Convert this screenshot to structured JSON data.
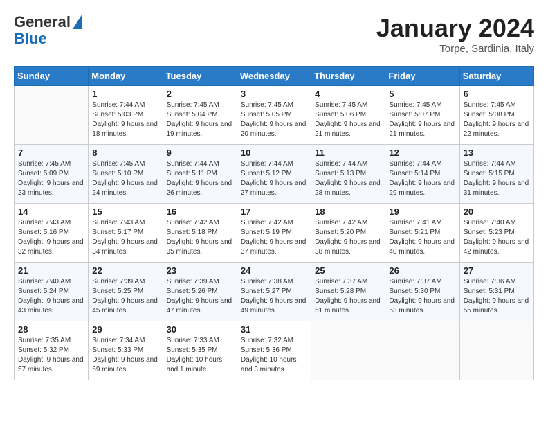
{
  "header": {
    "logo_general": "General",
    "logo_blue": "Blue",
    "month": "January 2024",
    "location": "Torpe, Sardinia, Italy"
  },
  "weekdays": [
    "Sunday",
    "Monday",
    "Tuesday",
    "Wednesday",
    "Thursday",
    "Friday",
    "Saturday"
  ],
  "weeks": [
    [
      {
        "day": "",
        "sunrise": "",
        "sunset": "",
        "daylight": ""
      },
      {
        "day": "1",
        "sunrise": "Sunrise: 7:44 AM",
        "sunset": "Sunset: 5:03 PM",
        "daylight": "Daylight: 9 hours and 18 minutes."
      },
      {
        "day": "2",
        "sunrise": "Sunrise: 7:45 AM",
        "sunset": "Sunset: 5:04 PM",
        "daylight": "Daylight: 9 hours and 19 minutes."
      },
      {
        "day": "3",
        "sunrise": "Sunrise: 7:45 AM",
        "sunset": "Sunset: 5:05 PM",
        "daylight": "Daylight: 9 hours and 20 minutes."
      },
      {
        "day": "4",
        "sunrise": "Sunrise: 7:45 AM",
        "sunset": "Sunset: 5:06 PM",
        "daylight": "Daylight: 9 hours and 21 minutes."
      },
      {
        "day": "5",
        "sunrise": "Sunrise: 7:45 AM",
        "sunset": "Sunset: 5:07 PM",
        "daylight": "Daylight: 9 hours and 21 minutes."
      },
      {
        "day": "6",
        "sunrise": "Sunrise: 7:45 AM",
        "sunset": "Sunset: 5:08 PM",
        "daylight": "Daylight: 9 hours and 22 minutes."
      }
    ],
    [
      {
        "day": "7",
        "sunrise": "Sunrise: 7:45 AM",
        "sunset": "Sunset: 5:09 PM",
        "daylight": "Daylight: 9 hours and 23 minutes."
      },
      {
        "day": "8",
        "sunrise": "Sunrise: 7:45 AM",
        "sunset": "Sunset: 5:10 PM",
        "daylight": "Daylight: 9 hours and 24 minutes."
      },
      {
        "day": "9",
        "sunrise": "Sunrise: 7:44 AM",
        "sunset": "Sunset: 5:11 PM",
        "daylight": "Daylight: 9 hours and 26 minutes."
      },
      {
        "day": "10",
        "sunrise": "Sunrise: 7:44 AM",
        "sunset": "Sunset: 5:12 PM",
        "daylight": "Daylight: 9 hours and 27 minutes."
      },
      {
        "day": "11",
        "sunrise": "Sunrise: 7:44 AM",
        "sunset": "Sunset: 5:13 PM",
        "daylight": "Daylight: 9 hours and 28 minutes."
      },
      {
        "day": "12",
        "sunrise": "Sunrise: 7:44 AM",
        "sunset": "Sunset: 5:14 PM",
        "daylight": "Daylight: 9 hours and 29 minutes."
      },
      {
        "day": "13",
        "sunrise": "Sunrise: 7:44 AM",
        "sunset": "Sunset: 5:15 PM",
        "daylight": "Daylight: 9 hours and 31 minutes."
      }
    ],
    [
      {
        "day": "14",
        "sunrise": "Sunrise: 7:43 AM",
        "sunset": "Sunset: 5:16 PM",
        "daylight": "Daylight: 9 hours and 32 minutes."
      },
      {
        "day": "15",
        "sunrise": "Sunrise: 7:43 AM",
        "sunset": "Sunset: 5:17 PM",
        "daylight": "Daylight: 9 hours and 34 minutes."
      },
      {
        "day": "16",
        "sunrise": "Sunrise: 7:42 AM",
        "sunset": "Sunset: 5:18 PM",
        "daylight": "Daylight: 9 hours and 35 minutes."
      },
      {
        "day": "17",
        "sunrise": "Sunrise: 7:42 AM",
        "sunset": "Sunset: 5:19 PM",
        "daylight": "Daylight: 9 hours and 37 minutes."
      },
      {
        "day": "18",
        "sunrise": "Sunrise: 7:42 AM",
        "sunset": "Sunset: 5:20 PM",
        "daylight": "Daylight: 9 hours and 38 minutes."
      },
      {
        "day": "19",
        "sunrise": "Sunrise: 7:41 AM",
        "sunset": "Sunset: 5:21 PM",
        "daylight": "Daylight: 9 hours and 40 minutes."
      },
      {
        "day": "20",
        "sunrise": "Sunrise: 7:40 AM",
        "sunset": "Sunset: 5:23 PM",
        "daylight": "Daylight: 9 hours and 42 minutes."
      }
    ],
    [
      {
        "day": "21",
        "sunrise": "Sunrise: 7:40 AM",
        "sunset": "Sunset: 5:24 PM",
        "daylight": "Daylight: 9 hours and 43 minutes."
      },
      {
        "day": "22",
        "sunrise": "Sunrise: 7:39 AM",
        "sunset": "Sunset: 5:25 PM",
        "daylight": "Daylight: 9 hours and 45 minutes."
      },
      {
        "day": "23",
        "sunrise": "Sunrise: 7:39 AM",
        "sunset": "Sunset: 5:26 PM",
        "daylight": "Daylight: 9 hours and 47 minutes."
      },
      {
        "day": "24",
        "sunrise": "Sunrise: 7:38 AM",
        "sunset": "Sunset: 5:27 PM",
        "daylight": "Daylight: 9 hours and 49 minutes."
      },
      {
        "day": "25",
        "sunrise": "Sunrise: 7:37 AM",
        "sunset": "Sunset: 5:28 PM",
        "daylight": "Daylight: 9 hours and 51 minutes."
      },
      {
        "day": "26",
        "sunrise": "Sunrise: 7:37 AM",
        "sunset": "Sunset: 5:30 PM",
        "daylight": "Daylight: 9 hours and 53 minutes."
      },
      {
        "day": "27",
        "sunrise": "Sunrise: 7:36 AM",
        "sunset": "Sunset: 5:31 PM",
        "daylight": "Daylight: 9 hours and 55 minutes."
      }
    ],
    [
      {
        "day": "28",
        "sunrise": "Sunrise: 7:35 AM",
        "sunset": "Sunset: 5:32 PM",
        "daylight": "Daylight: 9 hours and 57 minutes."
      },
      {
        "day": "29",
        "sunrise": "Sunrise: 7:34 AM",
        "sunset": "Sunset: 5:33 PM",
        "daylight": "Daylight: 9 hours and 59 minutes."
      },
      {
        "day": "30",
        "sunrise": "Sunrise: 7:33 AM",
        "sunset": "Sunset: 5:35 PM",
        "daylight": "Daylight: 10 hours and 1 minute."
      },
      {
        "day": "31",
        "sunrise": "Sunrise: 7:32 AM",
        "sunset": "Sunset: 5:36 PM",
        "daylight": "Daylight: 10 hours and 3 minutes."
      },
      {
        "day": "",
        "sunrise": "",
        "sunset": "",
        "daylight": ""
      },
      {
        "day": "",
        "sunrise": "",
        "sunset": "",
        "daylight": ""
      },
      {
        "day": "",
        "sunrise": "",
        "sunset": "",
        "daylight": ""
      }
    ]
  ]
}
